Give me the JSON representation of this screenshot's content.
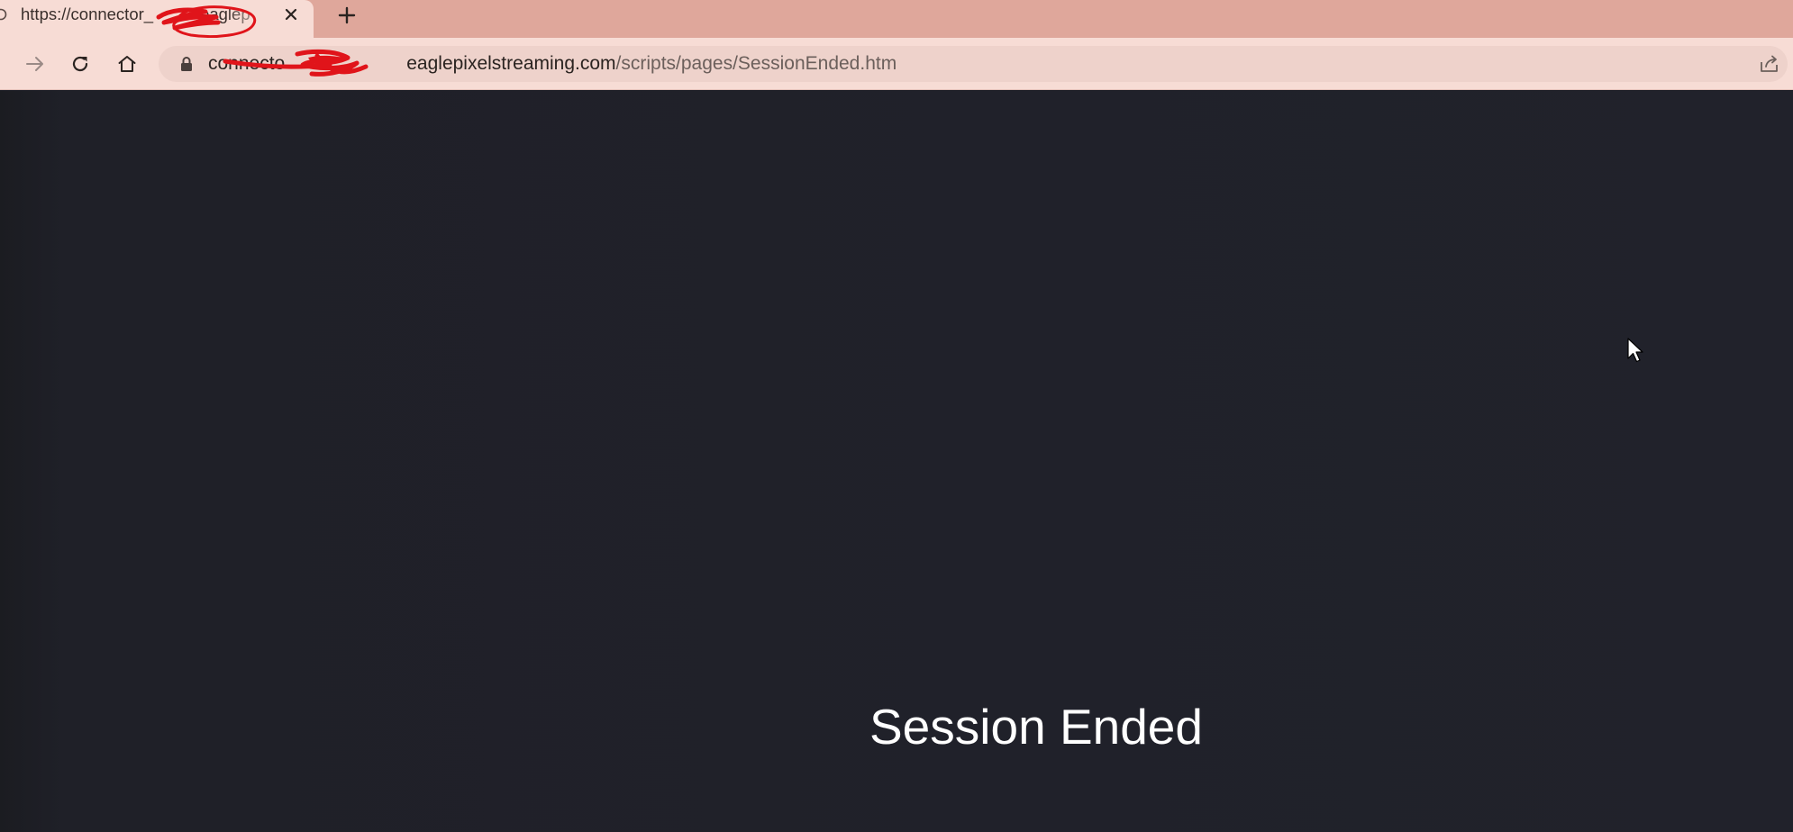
{
  "browser": {
    "tab": {
      "title": "https://connector_",
      "title_tail": "eaglep",
      "favicon": "globe-icon",
      "close_icon": "close-icon"
    },
    "new_tab_icon": "plus-icon",
    "toolbar": {
      "forward_icon": "arrow-right-icon",
      "reload_icon": "reload-icon",
      "home_icon": "home-icon",
      "lock_icon": "lock-icon",
      "share_icon": "share-icon"
    },
    "address_bar": {
      "url_host_start": "connecto",
      "url_host_end": "eaglepixelstreaming.com",
      "url_path": "/scripts/pages/SessionEnded.htm"
    },
    "colors": {
      "tabstrip": "#dfa79b",
      "active_tab": "#f7dcd5",
      "omnibox": "#eed2cb",
      "redaction_scribble": "#e0141a"
    }
  },
  "page": {
    "message": "Session Ended",
    "background": "#1f2028",
    "text_color": "#ffffff"
  }
}
